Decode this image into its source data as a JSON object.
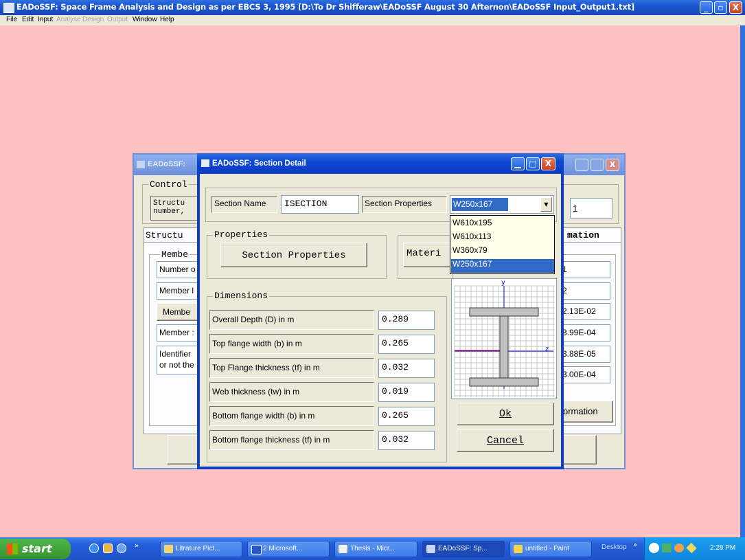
{
  "window": {
    "title": "EADoSSF: Space Frame Analysis and Design as per EBCS 3, 1995 [D:\\To Dr Shifferaw\\EADoSSF August 30 Afternon\\EADoSSF Input_Output1.txt]",
    "min": "_",
    "max": "▫",
    "close": "X"
  },
  "menu": [
    "File",
    "Edit",
    "Input",
    "Analyse",
    "Design",
    "Output",
    "Window",
    "Help"
  ],
  "bgwindow": {
    "title": "EADoSSF:",
    "control_legend": "Control",
    "structure_text": "Structu",
    "number_text": "number,",
    "control_value": "1",
    "tab_structure": "Structu",
    "tab_information": "mation",
    "member_legend": "Membe",
    "left_labels": [
      "Number o",
      "Member l",
      "Membe",
      "Member :",
      "Identifier",
      "or not the"
    ],
    "right_values": [
      "1",
      "2",
      "2.13E-02",
      "3.99E-04",
      "3.88E-05",
      "3.00E-04"
    ],
    "info_button": "ormation"
  },
  "dialog": {
    "title": "EADoSSF: Section Detail",
    "section_name_label": "Section Name",
    "section_name_value": "ISECTION",
    "section_props_label": "Section Properties",
    "selected_section": "W250x167",
    "dropdown_options": [
      "W610x195",
      "W610x113",
      "W360x79",
      "W250x167"
    ],
    "properties_legend": "Properties",
    "section_properties_button": "Section Properties",
    "material_text": "Materi",
    "dimensions_legend": "Dimensions",
    "dimensions": [
      {
        "label": "Overall Depth (D) in m",
        "value": "0.289"
      },
      {
        "label": "Top flange width (b) in m",
        "value": "0.265"
      },
      {
        "label": "Top Flange thickness (tf) in m",
        "value": "0.032"
      },
      {
        "label": "Web thickness (tw) in m",
        "value": "0.019"
      },
      {
        "label": "Bottom flange width (b) in m",
        "value": "0.265"
      },
      {
        "label": "Bottom flange thickness (tf) in m",
        "value": "0.032"
      }
    ],
    "axis_y": "y",
    "axis_z": "z",
    "ok": "Ok",
    "cancel": "Cancel"
  },
  "taskbar": {
    "start": "start",
    "tasks": [
      "Litrature Pict...",
      "2 Microsoft...",
      "Thesis - Micr...",
      "EADoSSF: Sp...",
      "untitled - Paint"
    ],
    "desktop": "Desktop",
    "time": "2:28 PM"
  }
}
